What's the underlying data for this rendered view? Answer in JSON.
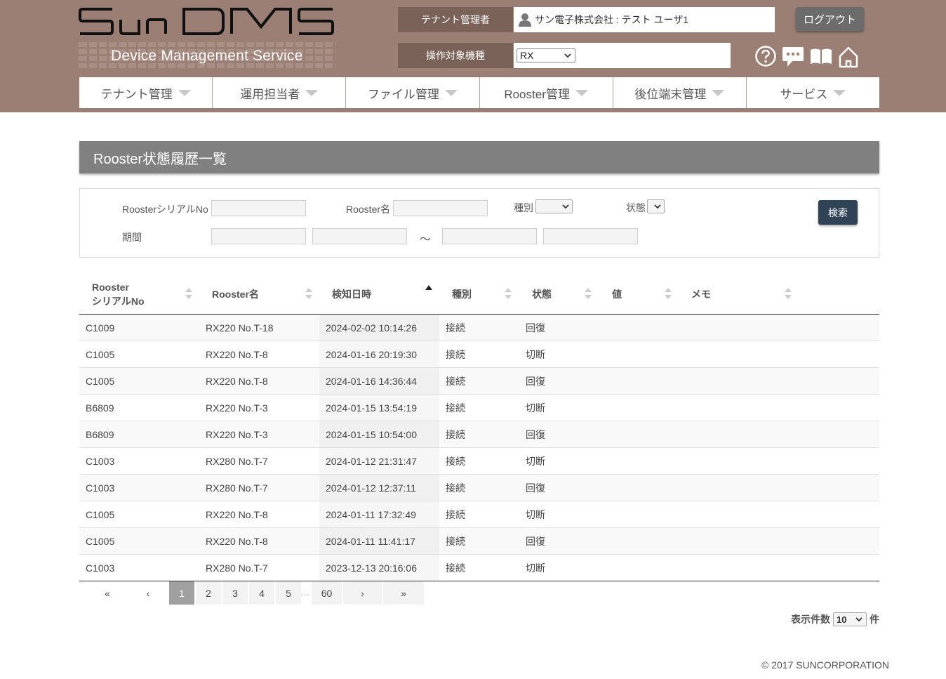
{
  "header": {
    "logo_text": "SunDMS",
    "logo_subtitle": "Device Management Service",
    "tenant_admin_label": "テナント管理者",
    "user_name": "サン電子株式会社 : テスト ユーザ1",
    "target_model_label": "操作対象機種",
    "target_model_value": "RX",
    "logout_label": "ログアウト",
    "icons": [
      "help-icon",
      "chat-icon",
      "manual-icon",
      "home-icon"
    ]
  },
  "nav": [
    {
      "label": "テナント管理"
    },
    {
      "label": "運用担当者"
    },
    {
      "label": "ファイル管理"
    },
    {
      "label": "Rooster管理"
    },
    {
      "label": "後位端末管理"
    },
    {
      "label": "サービス"
    }
  ],
  "page": {
    "title": "Rooster状態履歴一覧"
  },
  "search": {
    "serial_label": "RoosterシリアルNo",
    "serial_value": "",
    "name_label": "Rooster名",
    "name_value": "",
    "type_label": "種別",
    "type_value": "",
    "status_label": "状態",
    "status_value": "",
    "period_label": "期間",
    "period_separator": "～",
    "search_label": "検索"
  },
  "table": {
    "columns": [
      {
        "line1": "Rooster",
        "line2": "シリアルNo"
      },
      {
        "line1": "Rooster名",
        "line2": ""
      },
      {
        "line1": "検知日時",
        "line2": ""
      },
      {
        "line1": "種別",
        "line2": ""
      },
      {
        "line1": "状態",
        "line2": ""
      },
      {
        "line1": "値",
        "line2": ""
      },
      {
        "line1": "メモ",
        "line2": ""
      }
    ],
    "sorted_column": "検知日時",
    "sort_direction": "ascending-arrow",
    "rows": [
      {
        "serial": "C1009",
        "name": "RX220 No.T-18",
        "datetime": "2024-02-02 10:14:26",
        "type": "接続",
        "status": "回復",
        "value": "",
        "memo": ""
      },
      {
        "serial": "C1005",
        "name": "RX220 No.T-8",
        "datetime": "2024-01-16 20:19:30",
        "type": "接続",
        "status": "切断",
        "value": "",
        "memo": ""
      },
      {
        "serial": "C1005",
        "name": "RX220 No.T-8",
        "datetime": "2024-01-16 14:36:44",
        "type": "接続",
        "status": "回復",
        "value": "",
        "memo": ""
      },
      {
        "serial": "B6809",
        "name": "RX220 No.T-3",
        "datetime": "2024-01-15 13:54:19",
        "type": "接続",
        "status": "切断",
        "value": "",
        "memo": ""
      },
      {
        "serial": "B6809",
        "name": "RX220 No.T-3",
        "datetime": "2024-01-15 10:54:00",
        "type": "接続",
        "status": "回復",
        "value": "",
        "memo": ""
      },
      {
        "serial": "C1003",
        "name": "RX280 No.T-7",
        "datetime": "2024-01-12 21:31:47",
        "type": "接続",
        "status": "切断",
        "value": "",
        "memo": ""
      },
      {
        "serial": "C1003",
        "name": "RX280 No.T-7",
        "datetime": "2024-01-12 12:37:11",
        "type": "接続",
        "status": "回復",
        "value": "",
        "memo": ""
      },
      {
        "serial": "C1005",
        "name": "RX220 No.T-8",
        "datetime": "2024-01-11 17:32:49",
        "type": "接続",
        "status": "切断",
        "value": "",
        "memo": ""
      },
      {
        "serial": "C1005",
        "name": "RX220 No.T-8",
        "datetime": "2024-01-11 11:41:17",
        "type": "接続",
        "status": "回復",
        "value": "",
        "memo": ""
      },
      {
        "serial": "C1003",
        "name": "RX280 No.T-7",
        "datetime": "2023-12-13 20:16:06",
        "type": "接続",
        "status": "切断",
        "value": "",
        "memo": ""
      }
    ]
  },
  "pagination": {
    "first": "«",
    "prev": "‹",
    "pages": [
      "1",
      "2",
      "3",
      "4",
      "5"
    ],
    "current": "1",
    "ellipsis": "…",
    "last_page": "60",
    "next": "›",
    "last": "»"
  },
  "per_page": {
    "label": "表示件数",
    "value": "10",
    "unit": "件"
  },
  "footer": {
    "copyright": "© 2017 SUNCORPORATION"
  },
  "colors": {
    "header_bg": "#9b7f74",
    "header_label_bg": "#7a6259",
    "title_bar_bg": "#808080",
    "search_button_bg": "#2f4256",
    "logout_button_bg": "#6c6c6c",
    "active_page_bg": "#a0a0a0"
  }
}
